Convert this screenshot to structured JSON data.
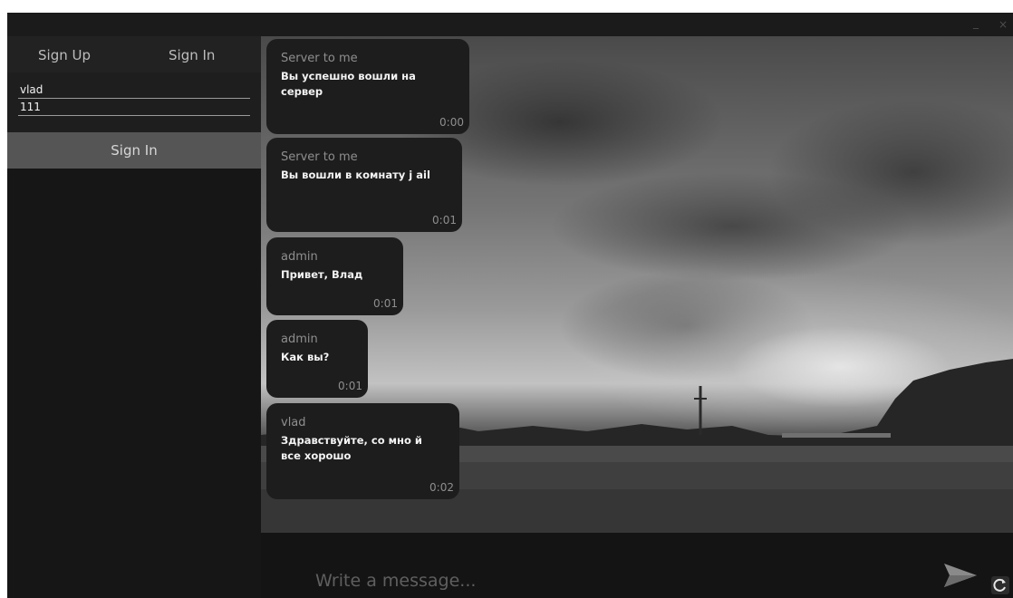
{
  "window": {
    "minimize_label": "_",
    "close_label": "×"
  },
  "auth": {
    "signup_tab": "Sign Up",
    "signin_tab": "Sign In",
    "login_value": "vlad",
    "password_value": "111",
    "submit_label": "Sign In"
  },
  "messages": [
    {
      "sender": "Server to me",
      "text": "Вы успешно вошли на сервер",
      "time": "0:00"
    },
    {
      "sender": "Server to me",
      "text": "Вы вошли в комнату j ail",
      "time": "0:01"
    },
    {
      "sender": "admin",
      "text": "Привет, Влад",
      "time": "0:01"
    },
    {
      "sender": "admin",
      "text": "Как вы?",
      "time": "0:01"
    },
    {
      "sender": "vlad",
      "text": "Здравствуйте, со мно й все хорошо",
      "time": "0:02"
    }
  ],
  "composer": {
    "placeholder": "Write a message..."
  },
  "icons": {
    "send": "send-arrow-icon",
    "refresh": "refresh-icon"
  },
  "colors": {
    "bubble": "#1d1d1d",
    "sidebar": "#161616",
    "button": "#555555"
  }
}
